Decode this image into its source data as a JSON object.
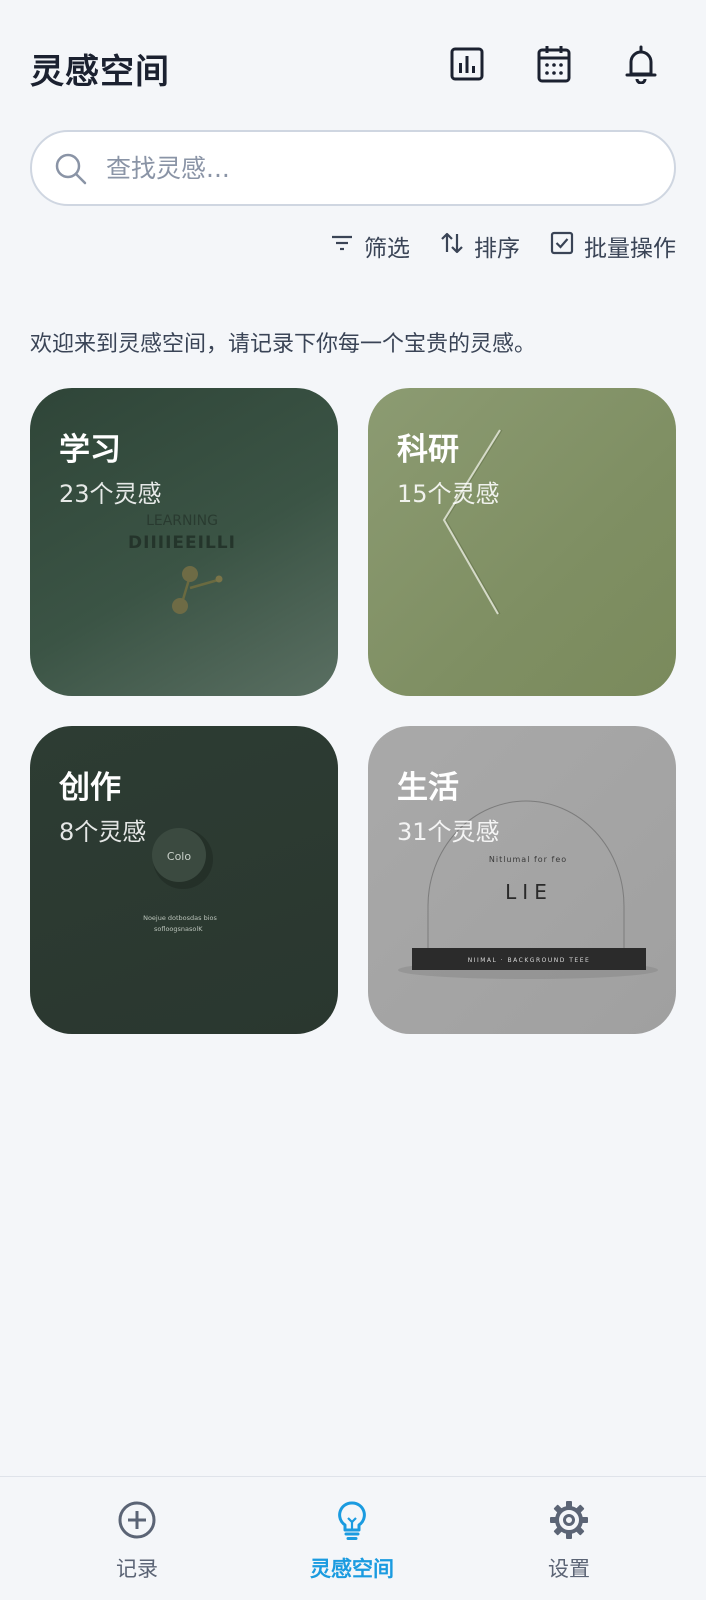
{
  "header": {
    "title": "灵感空间",
    "icons": [
      "chart-icon",
      "calendar-icon",
      "bell-icon"
    ]
  },
  "search": {
    "placeholder": "查找灵感...",
    "value": ""
  },
  "toolbar": {
    "filter_label": "筛选",
    "sort_label": "排序",
    "batch_label": "批量操作"
  },
  "welcome_text": "欢迎来到灵感空间，请记录下你每一个宝贵的灵感。",
  "categories": [
    {
      "name": "学习",
      "count": "23个灵感",
      "art_title": "LEARNING",
      "art_sub": "DIIIIEEILLI"
    },
    {
      "name": "科研",
      "count": "15个灵感"
    },
    {
      "name": "创作",
      "count": "8个灵感",
      "art_title": "Colo",
      "art_sub": "Noejue dotbosdas bios",
      "art_sub2": "sofloogsnasolK"
    },
    {
      "name": "生活",
      "count": "31个灵感",
      "art_title": "LIE",
      "art_sub": "Nitlumal for feo",
      "art_sub2": "NIIMAL · BACKGROUND TEEE"
    }
  ],
  "bottom_nav": {
    "items": [
      {
        "label": "记录",
        "icon": "plus-circle-icon",
        "active": false
      },
      {
        "label": "灵感空间",
        "icon": "lightbulb-icon",
        "active": true
      },
      {
        "label": "设置",
        "icon": "gear-icon",
        "active": false
      }
    ]
  },
  "colors": {
    "accent": "#1a9be0",
    "background": "#f4f6f9",
    "text_primary": "#1b2130",
    "text_secondary": "#3a4456"
  }
}
